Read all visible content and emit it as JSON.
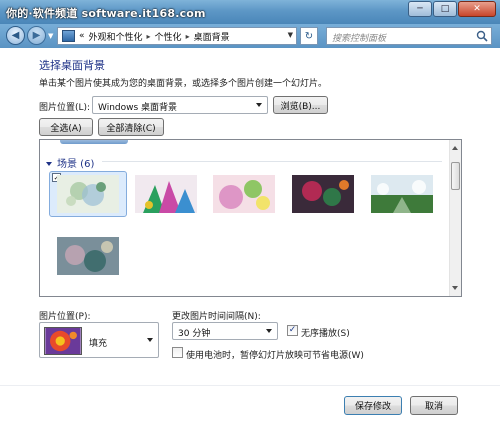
{
  "watermark": "你的·软件频道 software.it168.com",
  "caption": {
    "minimize": "─",
    "maximize": "□",
    "close": "✕"
  },
  "nav": {
    "breadcrumb": [
      "«",
      "外观和个性化",
      "个性化",
      "桌面背景"
    ],
    "search_placeholder": "搜索控制面板"
  },
  "page": {
    "title": "选择桌面背景",
    "description": "单击某个图片使其成为您的桌面背景，或选择多个图片创建一个幻灯片。"
  },
  "picture_location": {
    "label": "图片位置(L):",
    "value": "Windows 桌面背景",
    "browse": "浏览(B)..."
  },
  "actions": {
    "select_all": "全选(A)",
    "clear_all": "全部清除(C)"
  },
  "gallery": {
    "group_header": "场景 (6)",
    "first_item_checkmark": "✓",
    "thumbnails": [
      {
        "name": "scene-1",
        "colors": [
          "#e8efe4",
          "#a7c9a2",
          "#6aa07a"
        ]
      },
      {
        "name": "scene-2",
        "colors": [
          "#f1e9ef",
          "#c94aa6",
          "#2aa05e"
        ]
      },
      {
        "name": "scene-3",
        "colors": [
          "#f5dfe6",
          "#d98abf",
          "#7cc24d"
        ]
      },
      {
        "name": "scene-4",
        "colors": [
          "#3a2a3a",
          "#c02a56",
          "#2f7f4a"
        ]
      },
      {
        "name": "scene-5",
        "colors": [
          "#dde9f0",
          "#8fb58a",
          "#3e7a3a"
        ]
      },
      {
        "name": "scene-6",
        "colors": [
          "#7a8f9a",
          "#c7a6b5",
          "#3b6a6a"
        ]
      }
    ]
  },
  "position": {
    "label": "图片位置(P):",
    "value": "填充"
  },
  "interval": {
    "label": "更改图片时间间隔(N):",
    "value": "30 分钟",
    "shuffle_label": "无序播放(S)",
    "shuffle_checked": "✓",
    "battery_label": "使用电池时，暂停幻灯片放映可节省电源(W)"
  },
  "footer": {
    "save": "保存修改",
    "cancel": "取消"
  }
}
